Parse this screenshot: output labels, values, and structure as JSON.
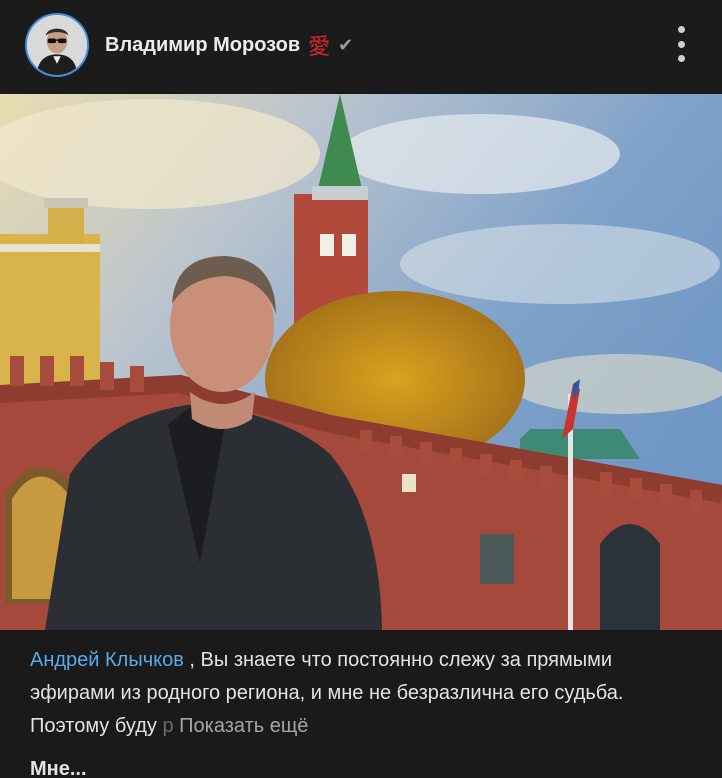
{
  "post": {
    "author_name": "Владимир Морозов",
    "author_emoji": "愛",
    "verified_icon": "check-icon",
    "menu_icon": "more-vertical-icon",
    "photo_description_icon": "photo",
    "caption_mention": "Андрей Клычков",
    "caption_text": " , Вы знаете что постоянно слежу за прямыми эфирами из родного региона, и мне не безразлична его судьба. Поэтому буду ",
    "caption_faded": "р",
    "show_more": "Показать ещё",
    "next_title_partial": "Мне..."
  },
  "colors": {
    "background": "#1a1a1a",
    "mention": "#5aa9ea",
    "avatar_ring": "#3d8fd9",
    "emoji": "#d8262b"
  }
}
